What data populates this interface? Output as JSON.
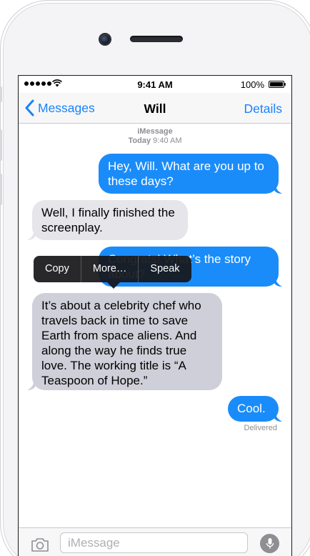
{
  "status_bar": {
    "time": "9:41 AM",
    "battery": "100%"
  },
  "nav": {
    "back_label": "Messages",
    "title": "Will",
    "details_label": "Details"
  },
  "thread": {
    "service": "iMessage",
    "date_day": "Today",
    "date_time": "9:40 AM"
  },
  "messages": [
    {
      "direction": "outgoing",
      "text": "Hey, Will. What are you up to these days?"
    },
    {
      "direction": "incoming",
      "text": "Well, I finally finished the screenplay."
    },
    {
      "direction": "outgoing",
      "text": "Congrats! What’s the story about?"
    },
    {
      "direction": "incoming",
      "text": "It’s about a celebrity chef who travels back in time to save Earth from space aliens. And along the way he finds true love. The working title is “A Teaspoon of Hope.”",
      "selected": true
    },
    {
      "direction": "outgoing",
      "text": "Cool."
    }
  ],
  "delivery_status": "Delivered",
  "context_menu": {
    "items": [
      "Copy",
      "More…",
      "Speak"
    ]
  },
  "input": {
    "placeholder": "iMessage",
    "value": ""
  },
  "colors": {
    "accent": "#1a82fb",
    "outgoing_bubble": "#1a8cfa",
    "incoming_bubble": "#e5e5ea",
    "selected_bubble": "#cfcfd9"
  },
  "icons": [
    "wifi-icon",
    "battery-icon",
    "chevron-left-icon",
    "camera-icon",
    "microphone-icon"
  ]
}
